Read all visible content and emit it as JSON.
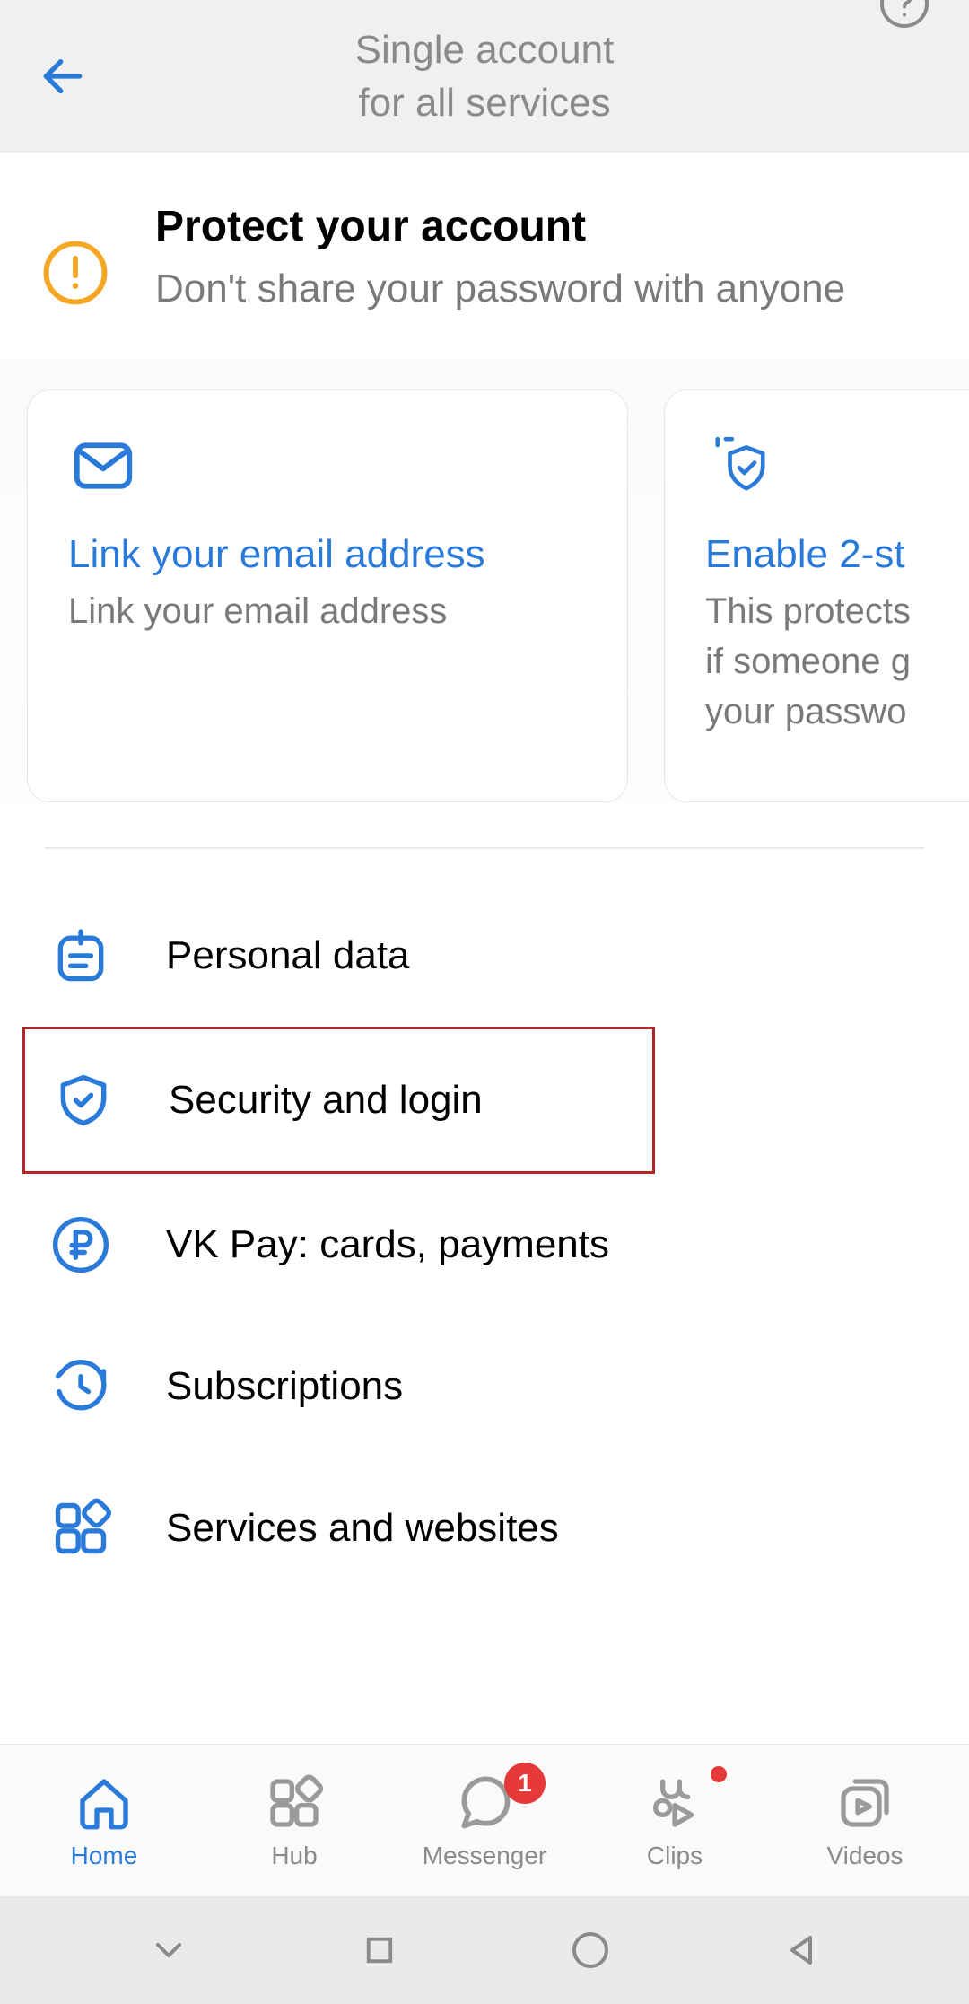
{
  "header": {
    "title_line1": "Single account",
    "title_line2": "for all services"
  },
  "alert": {
    "title": "Protect your account",
    "desc": "Don't share your password with anyone"
  },
  "cards": [
    {
      "title": "Link your email address",
      "desc": "Link your email address"
    },
    {
      "title": "Enable 2-st",
      "desc": "This protects if someone g your passwo"
    }
  ],
  "menu": [
    {
      "label": "Personal data"
    },
    {
      "label": "Security and login"
    },
    {
      "label": "VK Pay: cards, payments"
    },
    {
      "label": "Subscriptions"
    },
    {
      "label": "Services and websites"
    }
  ],
  "nav": [
    {
      "label": "Home"
    },
    {
      "label": "Hub"
    },
    {
      "label": "Messenger",
      "badge": "1"
    },
    {
      "label": "Clips"
    },
    {
      "label": "Videos"
    }
  ],
  "colors": {
    "accent": "#2a7ad9",
    "warning": "#f5a623",
    "danger": "#e63939",
    "muted": "#8a8a8a",
    "highlight_border": "#b22626"
  }
}
